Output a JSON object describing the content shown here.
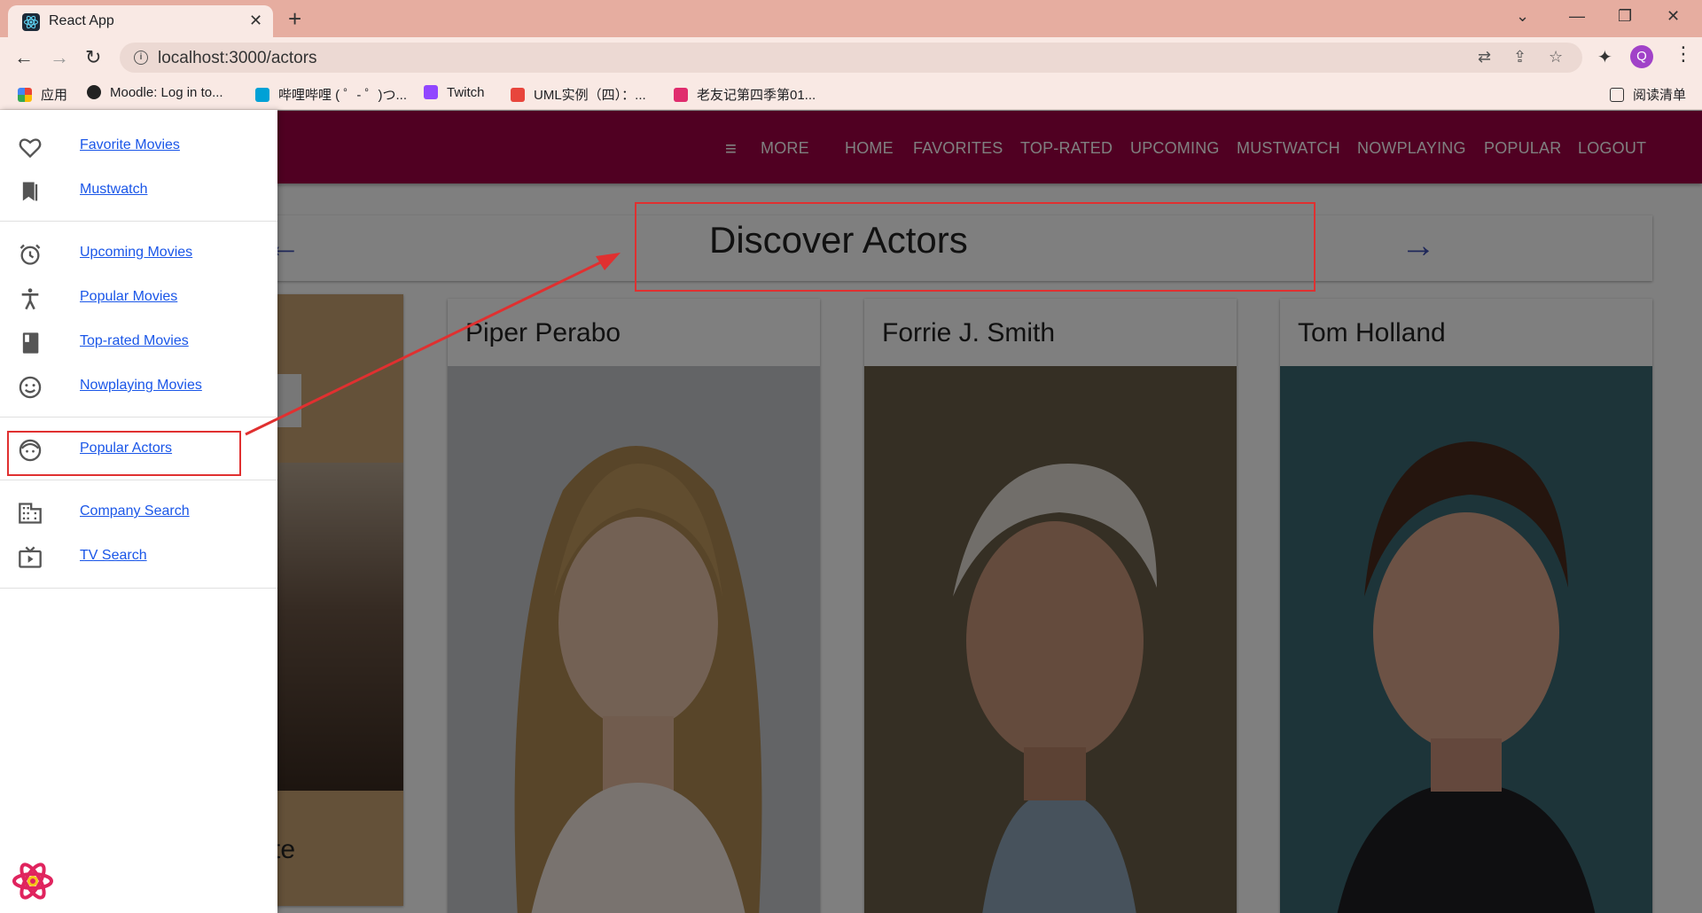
{
  "browser": {
    "tab_title": "React App",
    "tab_close": "✕",
    "new_tab": "+",
    "url": "localhost:3000/actors",
    "bookmarks": [
      "应用",
      "Moodle: Log in to...",
      "哔哩哔哩 ( ゜- ゜)つ...",
      "Twitch",
      "UML实例（四）：...",
      "老友记第四季第01..."
    ],
    "reading_list": "阅读清单",
    "profile_initial": "Q"
  },
  "appbar": {
    "more_label": "MORE",
    "links": [
      "HOME",
      "FAVORITES",
      "TOP-RATED",
      "UPCOMING",
      "MUSTWATCH",
      "NOWPLAYING",
      "POPULAR",
      "LOGOUT"
    ]
  },
  "header": {
    "title": "Discover Actors"
  },
  "actors": [
    {
      "name": "Piper Perabo"
    },
    {
      "name": "Forrie J. Smith"
    },
    {
      "name": "Tom Holland"
    }
  ],
  "left_card": {
    "partial_text": "te"
  },
  "drawer": {
    "items": [
      {
        "label": "Favorite Movies",
        "icon": "heart-icon"
      },
      {
        "label": "Mustwatch",
        "icon": "bookmark-icon"
      },
      {
        "label": "Upcoming Movies",
        "icon": "alarm-icon"
      },
      {
        "label": "Popular Movies",
        "icon": "accessibility-icon"
      },
      {
        "label": "Top-rated Movies",
        "icon": "book-icon"
      },
      {
        "label": "Nowplaying Movies",
        "icon": "smiley-icon"
      },
      {
        "label": "Popular Actors",
        "icon": "child-face-icon"
      },
      {
        "label": "Company Search",
        "icon": "building-icon"
      },
      {
        "label": "TV Search",
        "icon": "tv-icon"
      }
    ]
  },
  "colors": {
    "appbar": "#a10045",
    "link": "#1a56e8",
    "annotation": "#e03030",
    "arrow_accent": "#3f51b5"
  }
}
